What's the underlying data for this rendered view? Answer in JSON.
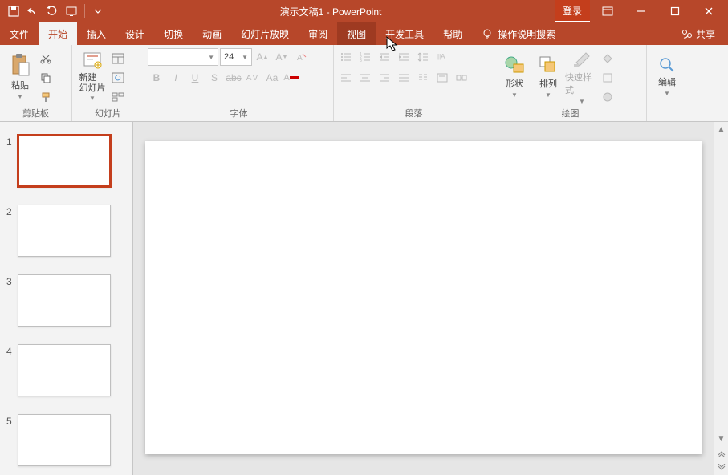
{
  "titlebar": {
    "title": "演示文稿1 - PowerPoint",
    "login": "登录"
  },
  "tabs": {
    "items": [
      "文件",
      "开始",
      "插入",
      "设计",
      "切换",
      "动画",
      "幻灯片放映",
      "审阅",
      "视图",
      "开发工具",
      "帮助"
    ],
    "active_index": 1,
    "hover_index": 8,
    "tell_me": "操作说明搜索",
    "share": "共享"
  },
  "ribbon": {
    "clipboard": {
      "paste": "粘贴",
      "label": "剪贴板"
    },
    "slides": {
      "new_slide": "新建\n幻灯片",
      "label": "幻灯片"
    },
    "font": {
      "size": "24",
      "label": "字体"
    },
    "paragraph": {
      "label": "段落"
    },
    "drawing": {
      "shapes": "形状",
      "arrange": "排列",
      "quick_styles": "快速样式",
      "label": "绘图"
    },
    "editing": {
      "edit": "编辑"
    }
  },
  "thumbnails": {
    "count": 5,
    "selected": 1
  }
}
